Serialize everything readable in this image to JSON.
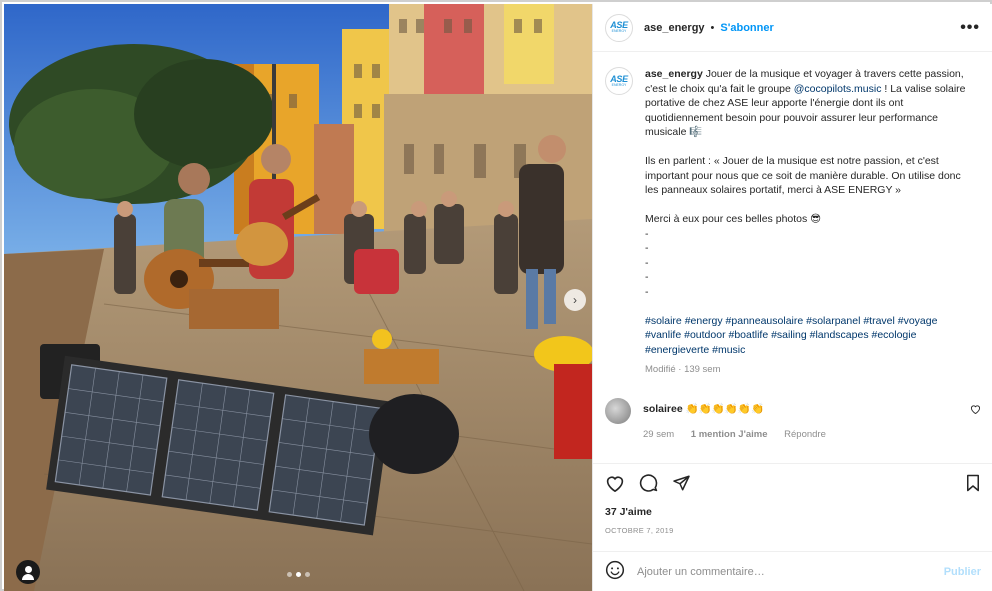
{
  "post": {
    "username": "ase_energy",
    "separator": "•",
    "follow_label": "S'abonner",
    "more_label": "•••",
    "avatar_text": "ASE",
    "avatar_sub": "ENERGY"
  },
  "caption": {
    "username": "ase_energy",
    "p1_a": " Jouer de la musique et voyager à travers cette passion, c'est le choix qu'a fait le groupe ",
    "p1_link": "@cocopilots.music",
    "p1_b": " ! La valise solaire portative de chez ASE leur apporte l'énergie dont ils ont quotidiennement besoin pour pouvoir assurer leur performance musicale 🎼",
    "p2": "Ils en parlent : « Jouer de la musique est notre passion, et c'est important pour nous que ce soit de manière durable. On utilise donc les panneaux solaires portatif, merci à ASE ENERGY »",
    "p3": "Merci à eux pour ces belles photos 😎",
    "dashes": [
      "-",
      "-",
      "-",
      "-",
      "-"
    ],
    "hashtags": "#solaire #energy #panneausolaire #solarpanel #travel #voyage #vanlife #outdoor #boatlife #sailing #landscapes #ecologie #energieverte #music",
    "meta": "Modifié · 139 sem"
  },
  "comment": {
    "username": "solairee",
    "text": " 👏👏👏👏👏👏",
    "age": "29 sem",
    "likes": "1 mention J'aime",
    "reply": "Répondre"
  },
  "actions": {
    "likes_count": "37 J'aime",
    "date": "OCTOBRE 7, 2019"
  },
  "add_comment": {
    "placeholder": "Ajouter un commentaire…",
    "publish": "Publier"
  },
  "carousel": {
    "total": 3,
    "current": 2
  }
}
